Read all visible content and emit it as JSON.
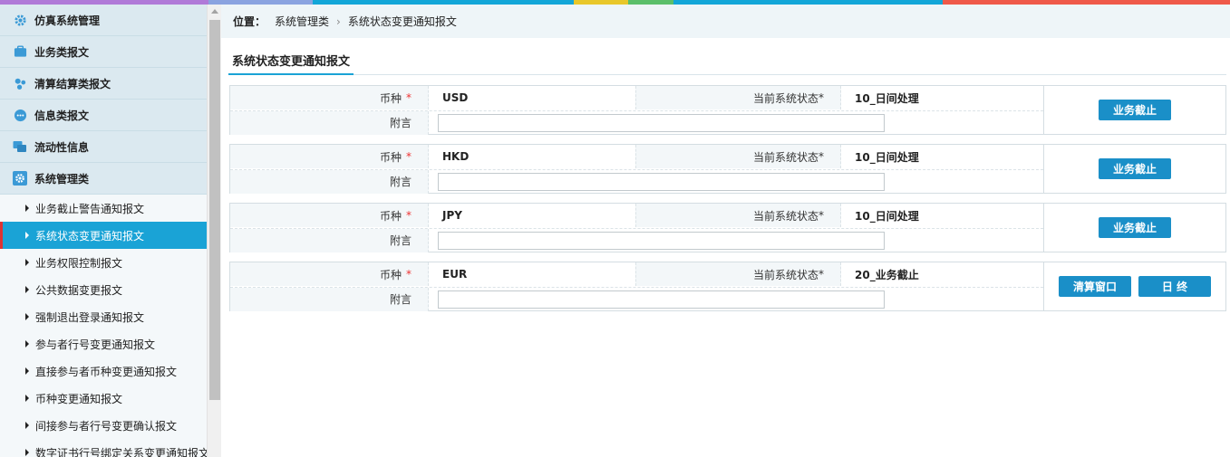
{
  "topstrip_colors": [
    "#b07ad8",
    "#8aa3e0",
    "#12a6d8",
    "#e8c72a",
    "#5bbf6a",
    "#12a6d8",
    "#ef5a4a"
  ],
  "sidebar": {
    "groups": [
      {
        "label": "仿真系统管理",
        "icon": "gear-icon"
      },
      {
        "label": "业务类报文",
        "icon": "briefcase-icon"
      },
      {
        "label": "清算结算类报文",
        "icon": "nodes-icon"
      },
      {
        "label": "信息类报文",
        "icon": "chat-icon"
      },
      {
        "label": "流动性信息",
        "icon": "comments-icon"
      },
      {
        "label": "系统管理类",
        "icon": "settings-icon"
      }
    ],
    "sub_items": [
      "业务截止警告通知报文",
      "系统状态变更通知报文",
      "业务权限控制报文",
      "公共数据变更报文",
      "强制退出登录通知报文",
      "参与者行号变更通知报文",
      "直接参与者币种变更通知报文",
      "币种变更通知报文",
      "间接参与者行号变更确认报文",
      "数字证书行号绑定关系变更通知报文"
    ]
  },
  "breadcrumb": {
    "label": "位置：",
    "path": [
      "系统管理类",
      "系统状态变更通知报文"
    ]
  },
  "tab": {
    "label": "系统状态变更通知报文"
  },
  "field_labels": {
    "currency": "币种",
    "status": "当前系统状态",
    "note": "附言",
    "required_mark": "*"
  },
  "panels": [
    {
      "currency": "USD",
      "status": "10_日间处理",
      "note": "",
      "buttons": [
        "业务截止"
      ]
    },
    {
      "currency": "HKD",
      "status": "10_日间处理",
      "note": "",
      "buttons": [
        "业务截止"
      ]
    },
    {
      "currency": "JPY",
      "status": "10_日间处理",
      "note": "",
      "buttons": [
        "业务截止"
      ]
    },
    {
      "currency": "EUR",
      "status": "20_业务截止",
      "note": "",
      "buttons": [
        "清算窗口",
        "日 终"
      ]
    }
  ]
}
